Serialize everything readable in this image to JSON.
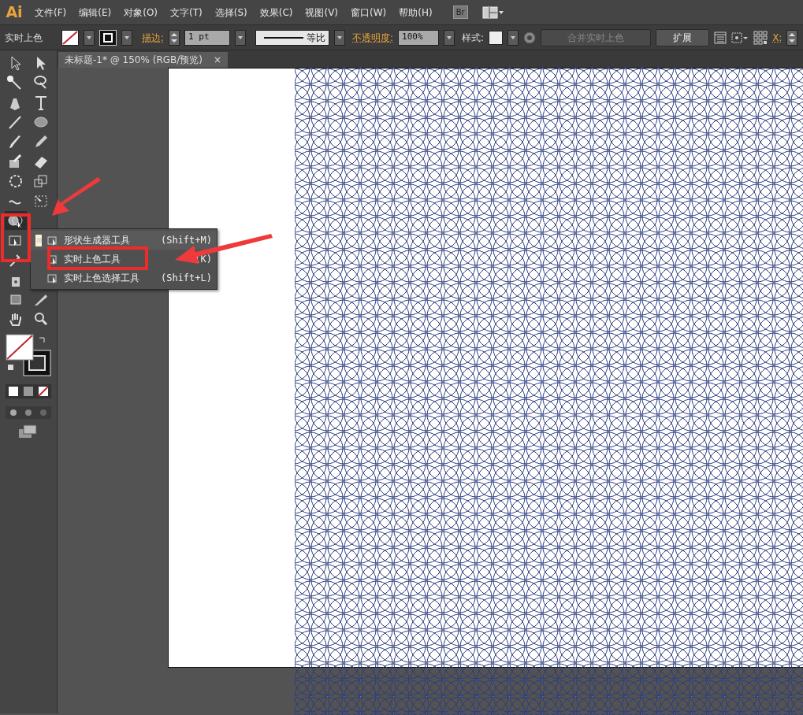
{
  "app_logo": "Ai",
  "menu": [
    "文件(F)",
    "编辑(E)",
    "对象(O)",
    "文字(T)",
    "选择(S)",
    "效果(C)",
    "视图(V)",
    "窗口(W)",
    "帮助(H)"
  ],
  "bridge_button": "Br",
  "control_bar": {
    "mode_label": "实时上色",
    "stroke_label": "描边:",
    "stroke_weight": "1 pt",
    "stroke_profile": "等比",
    "opacity_label": "不透明度:",
    "opacity": "100%",
    "style_label": "样式:",
    "buttons": [
      {
        "label": "合并实时上色",
        "disabled": true
      },
      {
        "label": "扩展",
        "disabled": false
      }
    ],
    "x_label": "X:"
  },
  "document_tab": {
    "title": "未标题-1* @ 150% (RGB/预览)",
    "close": "×"
  },
  "flyout": [
    {
      "label": "形状生成器工具",
      "shortcut": "(Shift+M)",
      "selected": true
    },
    {
      "label": "实时上色工具",
      "shortcut": "(K)",
      "selected": false
    },
    {
      "label": "实时上色选择工具",
      "shortcut": "(Shift+L)",
      "selected": false
    }
  ]
}
